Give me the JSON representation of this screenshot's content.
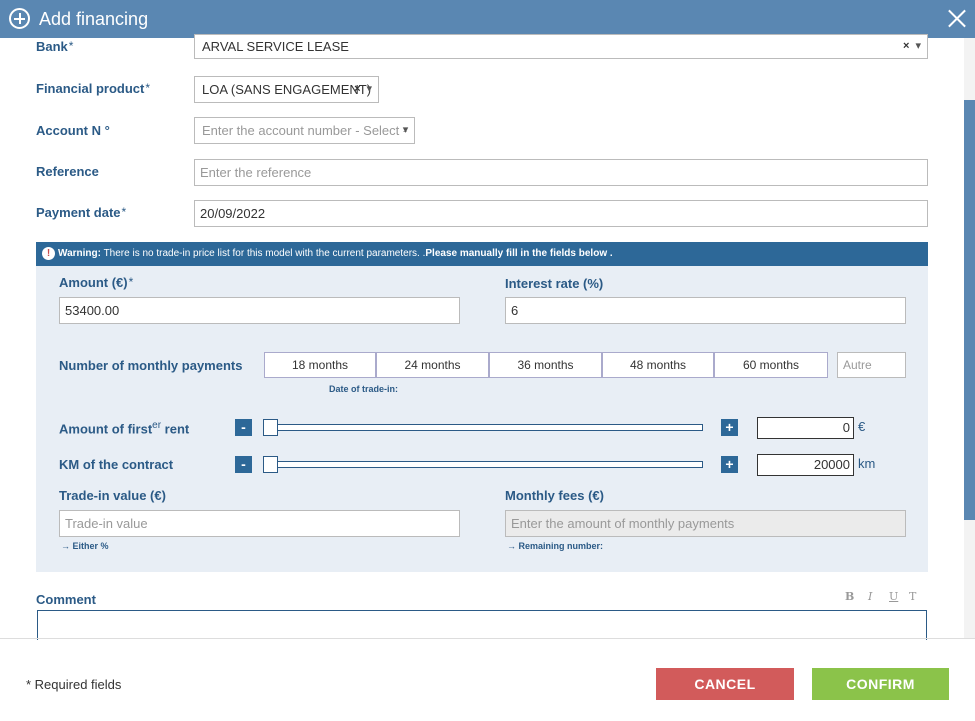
{
  "dialog": {
    "title": "Add financing"
  },
  "form": {
    "bank": {
      "label": "Bank",
      "value": "ARVAL SERVICE LEASE"
    },
    "financial_product": {
      "label": "Financial product",
      "value": "LOA (SANS ENGAGEMENT)"
    },
    "account": {
      "label": "Account N °",
      "placeholder": "Enter the account number - Select -"
    },
    "reference": {
      "label": "Reference",
      "placeholder": "Enter the reference"
    },
    "payment_date": {
      "label": "Payment date",
      "value": "20/09/2022"
    }
  },
  "required_mark": "*",
  "clear_glyph": "×",
  "dropdown_glyph": "▾",
  "warning": {
    "icon": "!",
    "prefix": "Warning:",
    "text": " There is no trade-in price list for this model with the current parameters. .",
    "emphasis": "Please manually fill in the fields below ."
  },
  "financing": {
    "amount": {
      "label": "Amount (€)",
      "value": "53400.00"
    },
    "interest_rate": {
      "label": "Interest rate (%)",
      "value": "6"
    },
    "monthly_payments": {
      "label": "Number of monthly payments",
      "options": [
        "18 months",
        "24 months",
        "36 months",
        "48 months",
        "60 months"
      ],
      "other_placeholder": "Autre",
      "note": "Date of trade-in:"
    },
    "first_rent": {
      "label_main": "Amount of first",
      "label_sup": "er",
      "label_tail": " rent",
      "value": "0",
      "unit": "€",
      "level": 0
    },
    "km": {
      "label": "KM of the contract",
      "value": "20000",
      "unit": "km",
      "level": 0
    },
    "trade_in": {
      "label": "Trade-in value (€)",
      "placeholder": "Trade-in value",
      "note": "→  Either %"
    },
    "monthly_fees": {
      "label": "Monthly fees (€)",
      "placeholder": "Enter the amount of monthly payments",
      "note": "→  Remaining number:"
    },
    "minus": "-",
    "plus": "+"
  },
  "comment": {
    "label": "Comment",
    "toolbar": {
      "bold": "B",
      "italic": "I",
      "underline": "U",
      "clear": "T"
    }
  },
  "footer": {
    "required_note": "* Required fields",
    "cancel": "CANCEL",
    "confirm": "CONFIRM"
  },
  "colors": {
    "header": "#5a87b2",
    "label": "#2b5a86",
    "warning_bar": "#2d6898",
    "cancel": "#d25b5b",
    "confirm": "#8bc34a"
  }
}
